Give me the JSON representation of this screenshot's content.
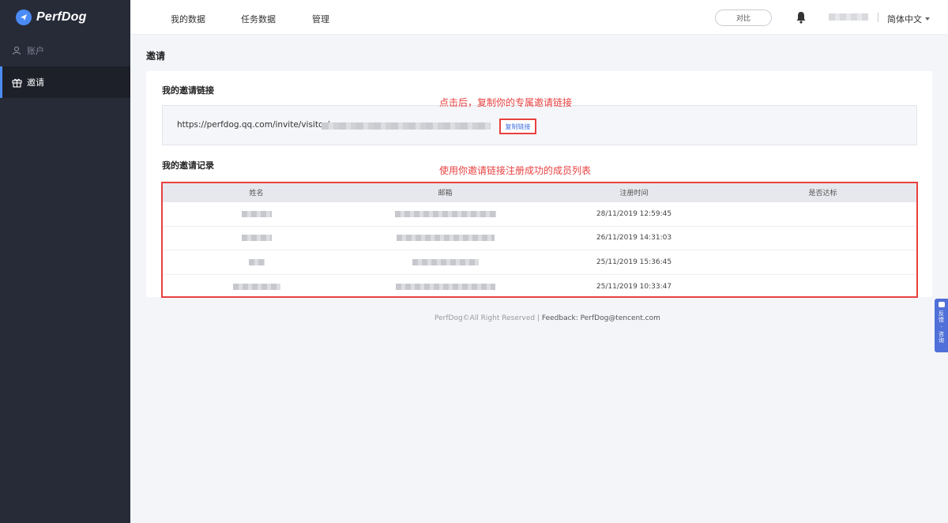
{
  "brand": {
    "name": "PerfDog"
  },
  "sidebar": {
    "items": [
      {
        "label": "账户",
        "icon": "user-icon"
      },
      {
        "label": "邀请",
        "icon": "gift-icon"
      }
    ]
  },
  "header": {
    "nav": [
      "我的数据",
      "任务数据",
      "管理"
    ],
    "compare_label": "对比",
    "bell_icon": "bell-icon",
    "language": "简体中文"
  },
  "page": {
    "title": "邀请",
    "link_section_title": "我的邀请链接",
    "invite_url": "https://perfdog.qq.com/invite/visitor/",
    "copy_button_label": "复制链接",
    "records_section_title": "我的邀请记录",
    "table": {
      "columns": [
        "姓名",
        "邮箱",
        "注册时间",
        "是否达标"
      ],
      "rows": [
        {
          "registered": "28/11/2019 12:59:45"
        },
        {
          "registered": "26/11/2019 14:31:03"
        },
        {
          "registered": "25/11/2019 15:36:45"
        },
        {
          "registered": "25/11/2019 10:33:47"
        }
      ]
    }
  },
  "annotations": {
    "copy_hint": "点击后，复制你的专属邀请链接",
    "table_hint": "使用你邀请链接注册成功的成员列表"
  },
  "footer": {
    "copyright": "PerfDog©All Right Reserved | ",
    "feedback": "Feedback: PerfDog@tencent.com"
  },
  "float_tab": {
    "label": "反馈 · 咨询"
  },
  "colors": {
    "sidebar_bg": "#272b38",
    "accent": "#4a8bf5",
    "annotation_red": "#e84040"
  }
}
